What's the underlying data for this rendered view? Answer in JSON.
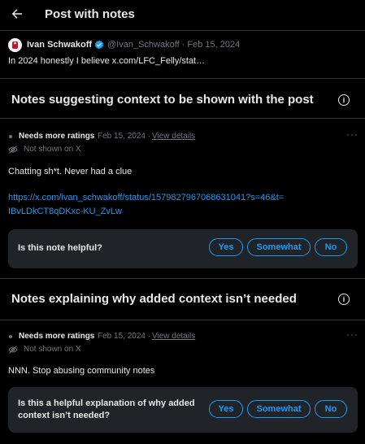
{
  "header": {
    "title": "Post with notes"
  },
  "post": {
    "author_name": "Ivan Schwakoff",
    "meta": "@Ivan_Schwakoff · Feb 15, 2024",
    "text": "In 2024 honestly I believe x.com/LFC_Felly/stat…"
  },
  "section1": {
    "title": "Notes suggesting context to be shown with the post",
    "note": {
      "status": "Needs more ratings",
      "date": "Feb 15, 2024 ·",
      "view_details": "View details",
      "not_shown": "Not shown on X",
      "text": "Chatting sh*t. Never had a clue",
      "link": "https://x.com/ivan_schwakoff/status/1579827967068631041?s=46&t=IBvLDkCT8qDKxc-KU_ZvLw"
    },
    "rate": {
      "question": "Is this note helpful?",
      "yes": "Yes",
      "somewhat": "Somewhat",
      "no": "No"
    }
  },
  "section2": {
    "title": "Notes explaining why added context isn’t needed",
    "note": {
      "status": "Needs more ratings",
      "date": "Feb 15, 2024 ·",
      "view_details": "View details",
      "not_shown": "Not shown on X",
      "text": "NNN. Stop abusing community notes"
    },
    "rate": {
      "question_line1": "Is this a helpful explanation of why added",
      "question_line2": "context isn’t needed?",
      "yes": "Yes",
      "somewhat": "Somewhat",
      "no": "No"
    }
  },
  "colors": {
    "accent": "#1d9bf0",
    "background": "#000000",
    "card": "#202327"
  },
  "icons": {
    "back": "back-arrow-icon",
    "verified": "verified-badge-icon",
    "info": "info-icon",
    "more": "more-icon",
    "eye_off": "eye-off-icon"
  }
}
